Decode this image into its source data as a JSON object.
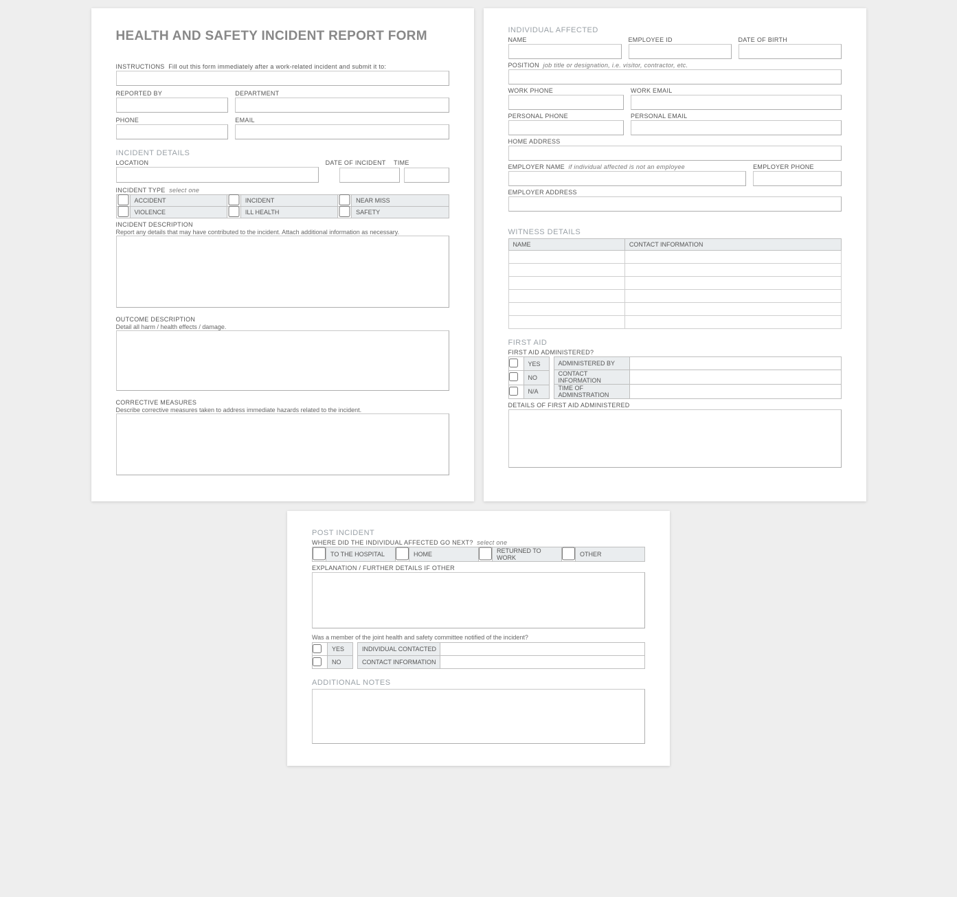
{
  "title": "HEALTH AND SAFETY INCIDENT REPORT FORM",
  "instructions": {
    "label": "INSTRUCTIONS",
    "text": "Fill out this form immediately after a work-related incident and submit it to:"
  },
  "reporter": {
    "reported_by": "REPORTED BY",
    "department": "DEPARTMENT",
    "phone": "PHONE",
    "email": "EMAIL"
  },
  "incident_details": {
    "heading": "INCIDENT DETAILS",
    "location": "LOCATION",
    "date_of_incident": "DATE OF INCIDENT",
    "time": "TIME",
    "type_label": "INCIDENT TYPE",
    "type_hint": "select one",
    "types": [
      "ACCIDENT",
      "INCIDENT",
      "NEAR MISS",
      "VIOLENCE",
      "ILL HEALTH",
      "SAFETY"
    ],
    "desc_label": "INCIDENT DESCRIPTION",
    "desc_sub": "Report any details that may have contributed to the incident.  Attach additional information as necessary.",
    "outcome_label": "OUTCOME DESCRIPTION",
    "outcome_sub": "Detail all harm / health effects / damage.",
    "corrective_label": "CORRECTIVE MEASURES",
    "corrective_sub": "Describe corrective measures taken to address immediate hazards related to the incident."
  },
  "individual": {
    "heading": "INDIVIDUAL AFFECTED",
    "name": "NAME",
    "employee_id": "EMPLOYEE ID",
    "dob": "DATE OF BIRTH",
    "position_label": "POSITION",
    "position_hint": "job title or designation, i.e. visitor, contractor, etc.",
    "work_phone": "WORK PHONE",
    "work_email": "WORK EMAIL",
    "personal_phone": "PERSONAL PHONE",
    "personal_email": "PERSONAL EMAIL",
    "home_address": "HOME ADDRESS",
    "employer_name_label": "EMPLOYER NAME",
    "employer_name_hint": "if individual affected is not an employee",
    "employer_phone": "EMPLOYER PHONE",
    "employer_address": "EMPLOYER ADDRESS"
  },
  "witness": {
    "heading": "WITNESS DETAILS",
    "col_name": "NAME",
    "col_contact": "CONTACT INFORMATION",
    "rows": 6
  },
  "first_aid": {
    "heading": "FIRST AID",
    "administered_q": "FIRST AID ADMINISTERED?",
    "yes": "YES",
    "no": "NO",
    "na": "N/A",
    "admin_by": "ADMINISTERED BY",
    "contact": "CONTACT INFORMATION",
    "time": "TIME OF ADMINSTRATION",
    "details_label": "DETAILS OF FIRST AID ADMINISTERED"
  },
  "post": {
    "heading": "POST INCIDENT",
    "where_label": "WHERE DID THE INDIVIDUAL AFFECTED GO NEXT?",
    "where_hint": "select one",
    "options": [
      "TO THE HOSPITAL",
      "HOME",
      "RETURNED TO WORK",
      "OTHER"
    ],
    "explanation": "EXPLANATION / FURTHER DETAILS IF OTHER",
    "committee_q": "Was a member of the joint health and safety committee notified of the incident?",
    "yes": "YES",
    "no": "NO",
    "individual_contacted": "INDIVIDUAL CONTACTED",
    "contact": "CONTACT INFORMATION"
  },
  "notes": {
    "heading": "ADDITIONAL NOTES"
  }
}
